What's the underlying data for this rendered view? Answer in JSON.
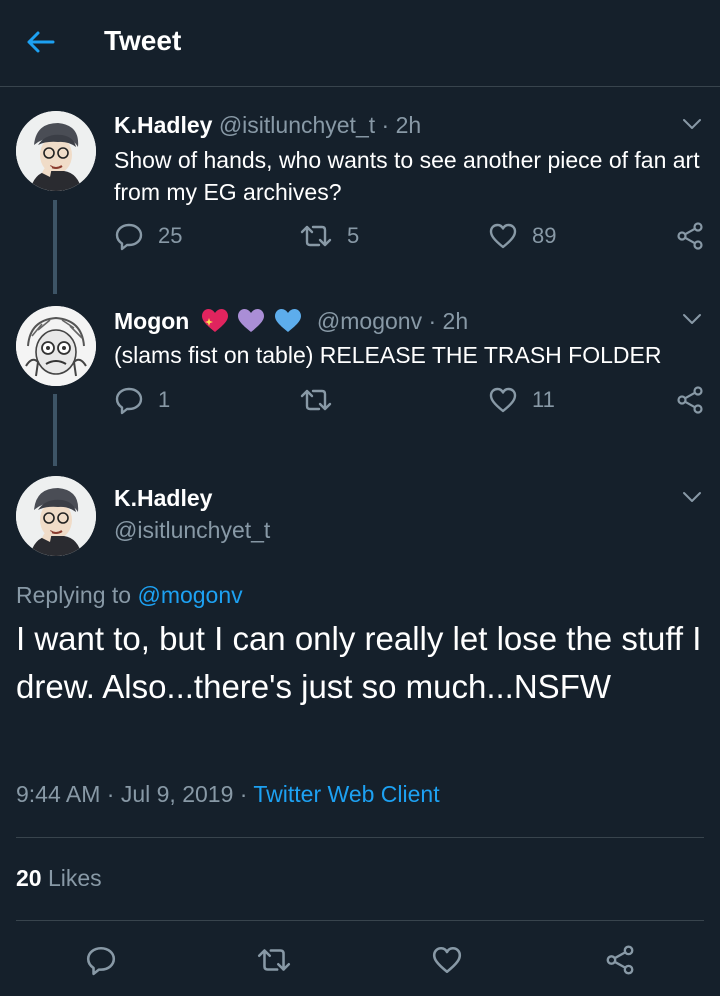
{
  "header": {
    "title": "Tweet",
    "back_icon": "arrow-left-icon"
  },
  "tweets": [
    {
      "name": "K.Hadley",
      "handle": "@isitlunchyet_t",
      "time": "· 2h",
      "text": "Show of hands, who wants to see another piece of fan art from my EG archives?",
      "replies": "25",
      "retweets": "5",
      "likes": "89"
    },
    {
      "name": "Mogon",
      "name_emojis": [
        "sparkling-heart-icon",
        "purple-heart-icon",
        "blue-heart-icon"
      ],
      "handle": "@mogonv",
      "time": "· 2h",
      "text": "(slams fist on table) RELEASE THE TRASH FOLDER",
      "replies": "1",
      "retweets": "",
      "likes": "11"
    }
  ],
  "main_tweet": {
    "name": "K.Hadley",
    "handle": "@isitlunchyet_t",
    "replying_prefix": "Replying to",
    "replying_to": "@mogonv",
    "text": "I want to, but I can only really let lose the stuff I drew. Also...there's just so much...NSFW",
    "time": "9:44 AM",
    "date": "Jul 9, 2019",
    "client": "Twitter Web Client",
    "likes_count": "20",
    "likes_label": "Likes"
  },
  "colors": {
    "background": "#15202b",
    "accent": "#1da1f2",
    "muted": "#8899a6",
    "divider": "#38444d"
  }
}
